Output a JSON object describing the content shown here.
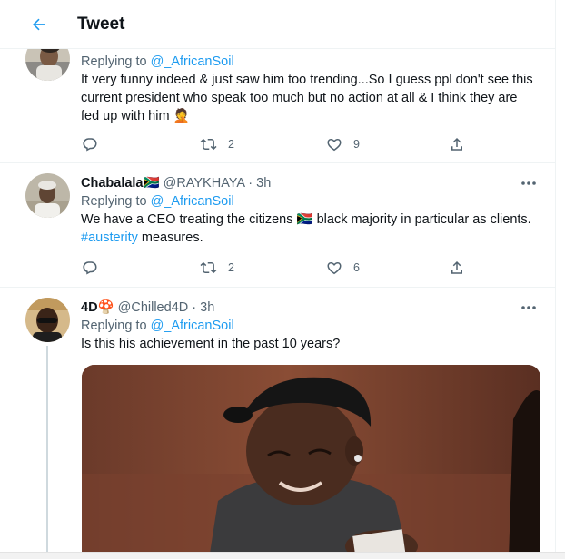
{
  "header": {
    "title": "Tweet"
  },
  "tweets": [
    {
      "replying_prefix": "Replying to",
      "replying_handle": "@_AfricanSoil",
      "text": "It very funny indeed & just saw him too trending...So I guess ppl don't see this current president who speak too much but no action at all & I think they are fed up with him",
      "emoji": "🤦",
      "retweets": "2",
      "likes": "9"
    },
    {
      "name": "Chabalala",
      "flag": "🇿🇦",
      "handle": "@RAYKHAYA",
      "separator": "·",
      "time": "3h",
      "replying_prefix": "Replying to",
      "replying_handle": "@_AfricanSoil",
      "text_a": "We have a CEO treating the citizens",
      "flag_inline": "🇿🇦",
      "text_b": "black majority in particular as clients.",
      "hashtag": "#austerity",
      "text_c": "measures.",
      "retweets": "2",
      "likes": "6"
    },
    {
      "name": "4D",
      "name_emoji": "🍄",
      "handle": "@Chilled4D",
      "separator": "·",
      "time": "3h",
      "replying_prefix": "Replying to",
      "replying_handle": "@_AfricanSoil",
      "text": "Is this his achievement in the past 10 years?"
    }
  ],
  "icons": {
    "back": "arrow-left-icon",
    "reply": "reply-icon",
    "retweet": "retweet-icon",
    "like": "heart-icon",
    "share": "share-icon",
    "more": "more-icon"
  },
  "colors": {
    "accent": "#1d9bf0",
    "text": "#0f1419",
    "secondary": "#536471",
    "border": "#eff3f4"
  }
}
